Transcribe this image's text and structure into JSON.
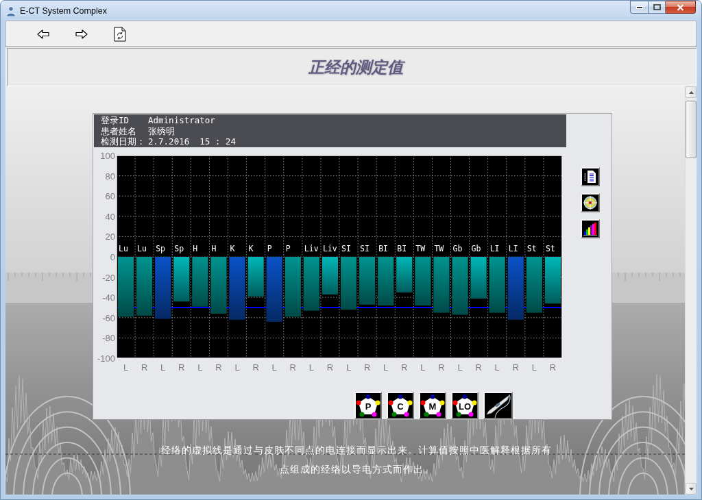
{
  "window": {
    "title": "E-CT System Complex"
  },
  "page_title": "正经的测定值",
  "record": [
    {
      "label": "登录ID",
      "value": "Administrator"
    },
    {
      "label": "患者姓名",
      "value": "张绣明"
    },
    {
      "label": "检测日期：",
      "value": "2.7.2016  15 : 24"
    }
  ],
  "chart": {
    "chart_data": {
      "type": "bar",
      "categories": [
        "L",
        "R",
        "L",
        "R",
        "L",
        "R",
        "L",
        "R",
        "L",
        "R",
        "L",
        "R",
        "L",
        "R",
        "L",
        "R",
        "L",
        "R",
        "L",
        "R",
        "L",
        "R",
        "L",
        "R"
      ],
      "value_labels": [
        "Lu",
        "Lu",
        "Sp",
        "Sp",
        "H",
        "H",
        "K",
        "K",
        "P",
        "P",
        "Liv",
        "Liv",
        "SI",
        "SI",
        "BI",
        "BI",
        "TW",
        "TW",
        "Gb",
        "Gb",
        "LI",
        "LI",
        "St",
        "St"
      ],
      "series": [
        {
          "color": "#00b8b8",
          "values": [
            null,
            null,
            null,
            -44,
            null,
            null,
            null,
            -39,
            null,
            null,
            null,
            -37,
            null,
            null,
            null,
            -35,
            null,
            null,
            null,
            -41,
            null,
            null,
            null,
            -46
          ]
        },
        {
          "color": "#00948f",
          "values": [
            -59,
            -58,
            null,
            null,
            -49,
            -56,
            null,
            null,
            null,
            -59,
            -53,
            null,
            -52,
            -47,
            -48,
            null,
            -48,
            -55,
            -57,
            null,
            -55,
            null,
            -55,
            null
          ]
        },
        {
          "color": "#0a52c8",
          "values": [
            null,
            null,
            -61,
            null,
            null,
            null,
            -62,
            null,
            -64,
            null,
            null,
            null,
            null,
            null,
            null,
            null,
            null,
            null,
            null,
            null,
            null,
            -62,
            null,
            null
          ]
        }
      ],
      "stacked": true,
      "grid": true,
      "ylim": [
        -100,
        100
      ],
      "yticks": [
        -100,
        -80,
        -60,
        -40,
        -20,
        0,
        20,
        40,
        60,
        80,
        100
      ],
      "ref_lines": [
        {
          "axis": "y",
          "value": -50,
          "color": "#0000ff"
        }
      ]
    }
  },
  "mode_buttons": [
    {
      "kind": "pentagon",
      "label": "P"
    },
    {
      "kind": "pentagon",
      "label": "C"
    },
    {
      "kind": "pentagon",
      "label": "M"
    },
    {
      "kind": "pentagon",
      "label": "LO"
    },
    {
      "kind": "probe"
    }
  ],
  "note": "经络的虚拟线是通过与皮肤不同点的电连接而显示出来。计算值按照中医解释根据所有点组成的经络以导电方式而作出。"
}
